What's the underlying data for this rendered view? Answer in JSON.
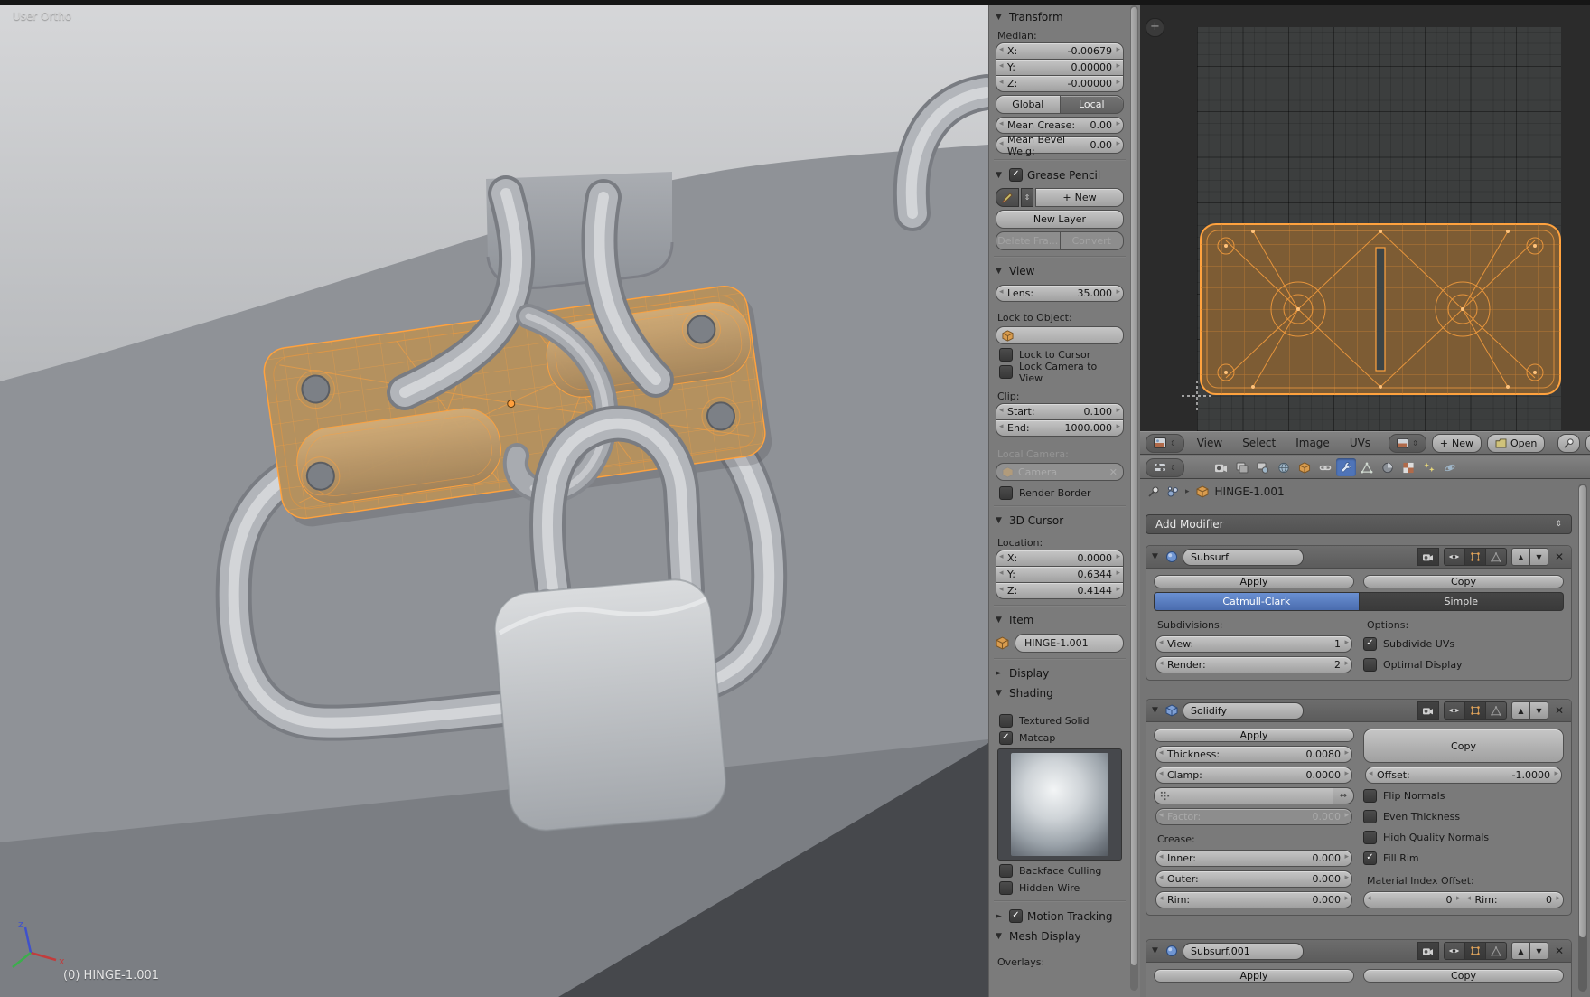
{
  "colors": {
    "accent_blue": "#4f74b8",
    "selection_orange": "#ffa23e",
    "catmull_blue": "#5a7fc4"
  },
  "icons": {
    "tri_down": "▼",
    "tri_right": "►",
    "check": "✓",
    "updown": "⇕",
    "close": "✕",
    "swap": "⇔",
    "plus": "+",
    "crumb_arrow": "▸",
    "up": "▲",
    "down": "▼"
  },
  "viewport": {
    "view_label": "User Ortho",
    "status_label": "(0) HINGE-1.001",
    "axis_x": "x",
    "axis_z": "z"
  },
  "npanel": {
    "transform": {
      "title": "Transform",
      "median_label": "Median:",
      "x_label": "X:",
      "x_value": "-0.00679",
      "y_label": "Y:",
      "y_value": "0.00000",
      "z_label": "Z:",
      "z_value": "-0.00000",
      "global_label": "Global",
      "local_label": "Local",
      "mean_crease_label": "Mean Crease:",
      "mean_crease_value": "0.00",
      "mean_bevel_label": "Mean Bevel Weig:",
      "mean_bevel_value": "0.00"
    },
    "grease_pencil": {
      "title": "Grease Pencil",
      "new_label": "New",
      "new_layer_label": "New Layer",
      "delete_frame_label": "Delete Fra...",
      "convert_label": "Convert"
    },
    "view": {
      "title": "View",
      "lens_label": "Lens:",
      "lens_value": "35.000",
      "lock_to_object_label": "Lock to Object:",
      "lock_to_cursor_label": "Lock to Cursor",
      "lock_camera_label": "Lock Camera to View",
      "clip_label": "Clip:",
      "clip_start_label": "Start:",
      "clip_start_value": "0.100",
      "clip_end_label": "End:",
      "clip_end_value": "1000.000",
      "local_camera_label": "Local Camera:",
      "camera_value": "Camera",
      "render_border_label": "Render Border"
    },
    "cursor3d": {
      "title": "3D Cursor",
      "location_label": "Location:",
      "x_label": "X:",
      "x_value": "0.0000",
      "y_label": "Y:",
      "y_value": "0.6344",
      "z_label": "Z:",
      "z_value": "0.4144"
    },
    "item": {
      "title": "Item",
      "name_value": "HINGE-1.001"
    },
    "display": {
      "title": "Display"
    },
    "shading": {
      "title": "Shading",
      "textured_solid_label": "Textured Solid",
      "matcap_label": "Matcap",
      "backface_label": "Backface Culling",
      "hidden_wire_label": "Hidden Wire"
    },
    "motion_tracking": {
      "title": "Motion Tracking"
    },
    "mesh_display": {
      "title": "Mesh Display",
      "overlays_label": "Overlays:"
    }
  },
  "uv_editor": {
    "menu_view": "View",
    "menu_select": "Select",
    "menu_image": "Image",
    "menu_uvs": "UVs",
    "new_label": "New",
    "open_label": "Open",
    "view_dropdown_label": "View"
  },
  "properties": {
    "object_name": "HINGE-1.001",
    "add_modifier_label": "Add Modifier",
    "apply_label": "Apply",
    "copy_label": "Copy",
    "subsurf": {
      "name": "Subsurf",
      "catmull_label": "Catmull-Clark",
      "simple_label": "Simple",
      "subdivisions_label": "Subdivisions:",
      "options_label": "Options:",
      "view_label": "View:",
      "view_value": "1",
      "render_label": "Render:",
      "render_value": "2",
      "subdivide_uvs_label": "Subdivide UVs",
      "optimal_display_label": "Optimal Display"
    },
    "solidify": {
      "name": "Solidify",
      "thickness_label": "Thickness:",
      "thickness_value": "0.0080",
      "offset_label": "Offset:",
      "offset_value": "-1.0000",
      "clamp_label": "Clamp:",
      "clamp_value": "0.0000",
      "factor_label": "Factor:",
      "factor_value": "0.000",
      "flip_normals_label": "Flip Normals",
      "even_thickness_label": "Even Thickness",
      "hq_normals_label": "High Quality Normals",
      "fill_rim_label": "Fill Rim",
      "crease_label": "Crease:",
      "inner_label": "Inner:",
      "inner_value": "0.000",
      "outer_label": "Outer:",
      "outer_value": "0.000",
      "rim_label": "Rim:",
      "rim_value": "0.000",
      "mat_index_label": "Material Index Offset:",
      "mat_index_value": "0",
      "rim_index_label": "Rim:",
      "rim_index_value": "0"
    },
    "subsurf2": {
      "name": "Subsurf.001"
    }
  }
}
